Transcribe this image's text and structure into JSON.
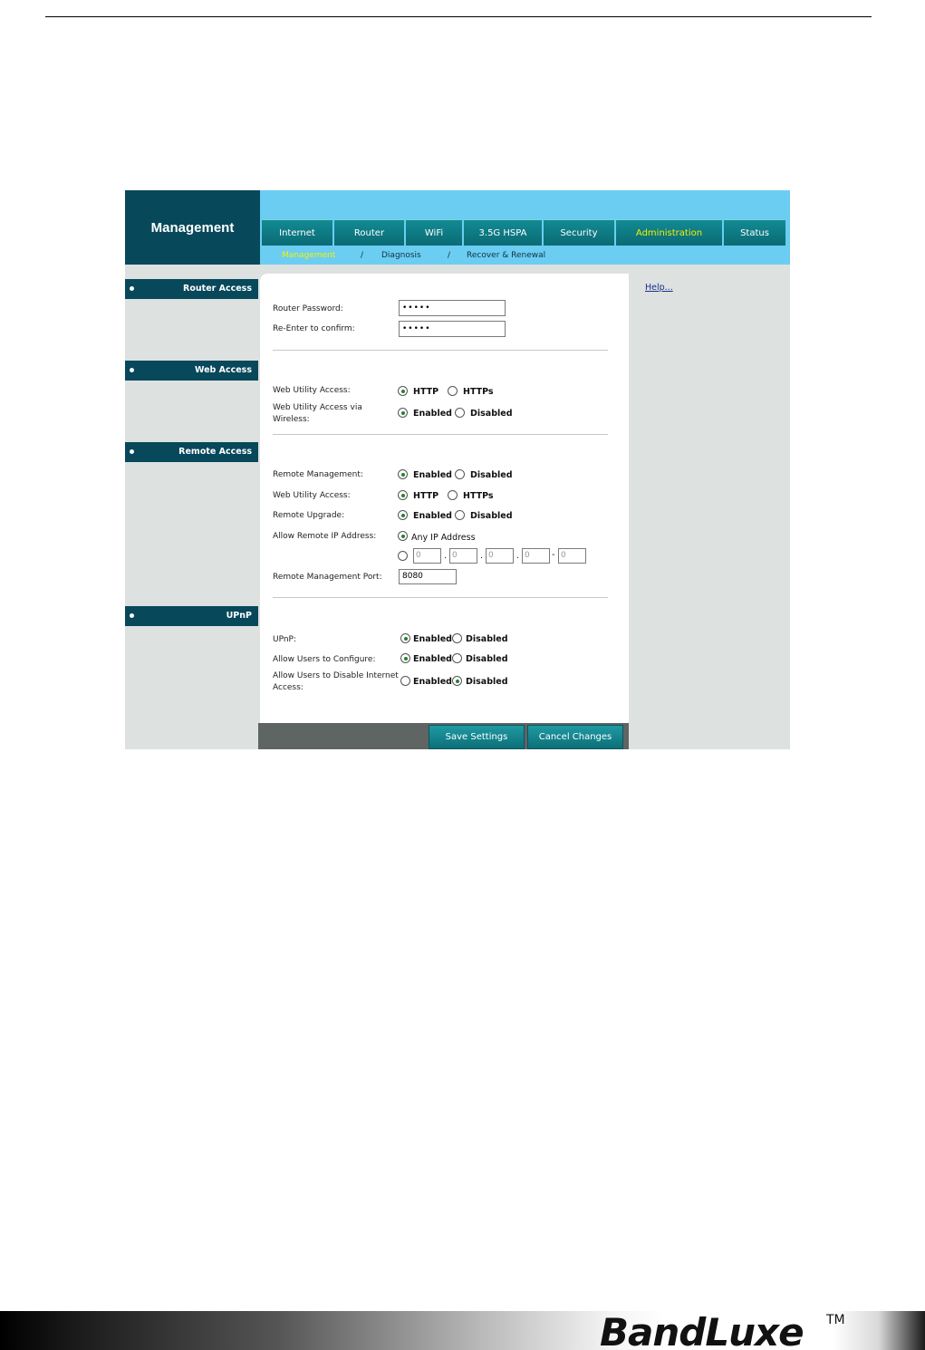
{
  "app": {
    "section_title": "Management",
    "tabs": [
      {
        "label": "Internet",
        "active": false
      },
      {
        "label": "Router",
        "active": false
      },
      {
        "label": "WiFi",
        "active": false
      },
      {
        "label": "3.5G HSPA",
        "active": false
      },
      {
        "label": "Security",
        "active": false
      },
      {
        "label": "Administration",
        "active": true
      },
      {
        "label": "Status",
        "active": false
      }
    ],
    "subnav": {
      "current": "Management",
      "sep1": "/",
      "diagnosis": "Diagnosis",
      "sep2": "/",
      "recover": "Recover & Renewal"
    }
  },
  "sidebar": {
    "router_access": "Router Access",
    "web_access": "Web Access",
    "remote_access": "Remote Access",
    "upnp": "UPnP"
  },
  "help": {
    "label": "Help..."
  },
  "router_access": {
    "password_label": "Router Password:",
    "password_value": "•••••",
    "confirm_label": "Re-Enter to confirm:",
    "confirm_value": "•••••"
  },
  "web_access": {
    "utility_label": "Web Utility Access:",
    "utility_opt1": "HTTP",
    "utility_opt2": "HTTPs",
    "wireless_label_1": "Web Utility Access via",
    "wireless_label_2": "Wireless:",
    "wireless_opt1": "Enabled",
    "wireless_opt2": "Disabled"
  },
  "remote_access": {
    "mgmt_label": "Remote Management:",
    "mgmt_opt1": "Enabled",
    "mgmt_opt2": "Disabled",
    "utility_label": "Web Utility Access:",
    "utility_opt1": "HTTP",
    "utility_opt2": "HTTPs",
    "upgrade_label": "Remote Upgrade:",
    "upgrade_opt1": "Enabled",
    "upgrade_opt2": "Disabled",
    "allow_ip_label": "Allow Remote IP Address:",
    "any_ip": "Any IP Address",
    "ip1": "0",
    "ip2": "0",
    "ip3": "0",
    "ip4": "0",
    "ip5": "0",
    "dot": ".",
    "dash": "-",
    "port_label": "Remote Management Port:",
    "port_value": "8080"
  },
  "upnp": {
    "upnp_label": "UPnP:",
    "upnp_opt1": "Enabled",
    "upnp_opt2": "Disabled",
    "config_label": "Allow Users to Configure:",
    "config_opt1": "Enabled",
    "config_opt2": "Disabled",
    "disable_label_1": "Allow Users to Disable Internet",
    "disable_label_2": "Access:",
    "disable_opt1": "Enabled",
    "disable_opt2": "Disabled"
  },
  "buttons": {
    "save": "Save Settings",
    "cancel": "Cancel Changes"
  },
  "footer": {
    "logo": "BandLuxe",
    "tm": "TM"
  }
}
